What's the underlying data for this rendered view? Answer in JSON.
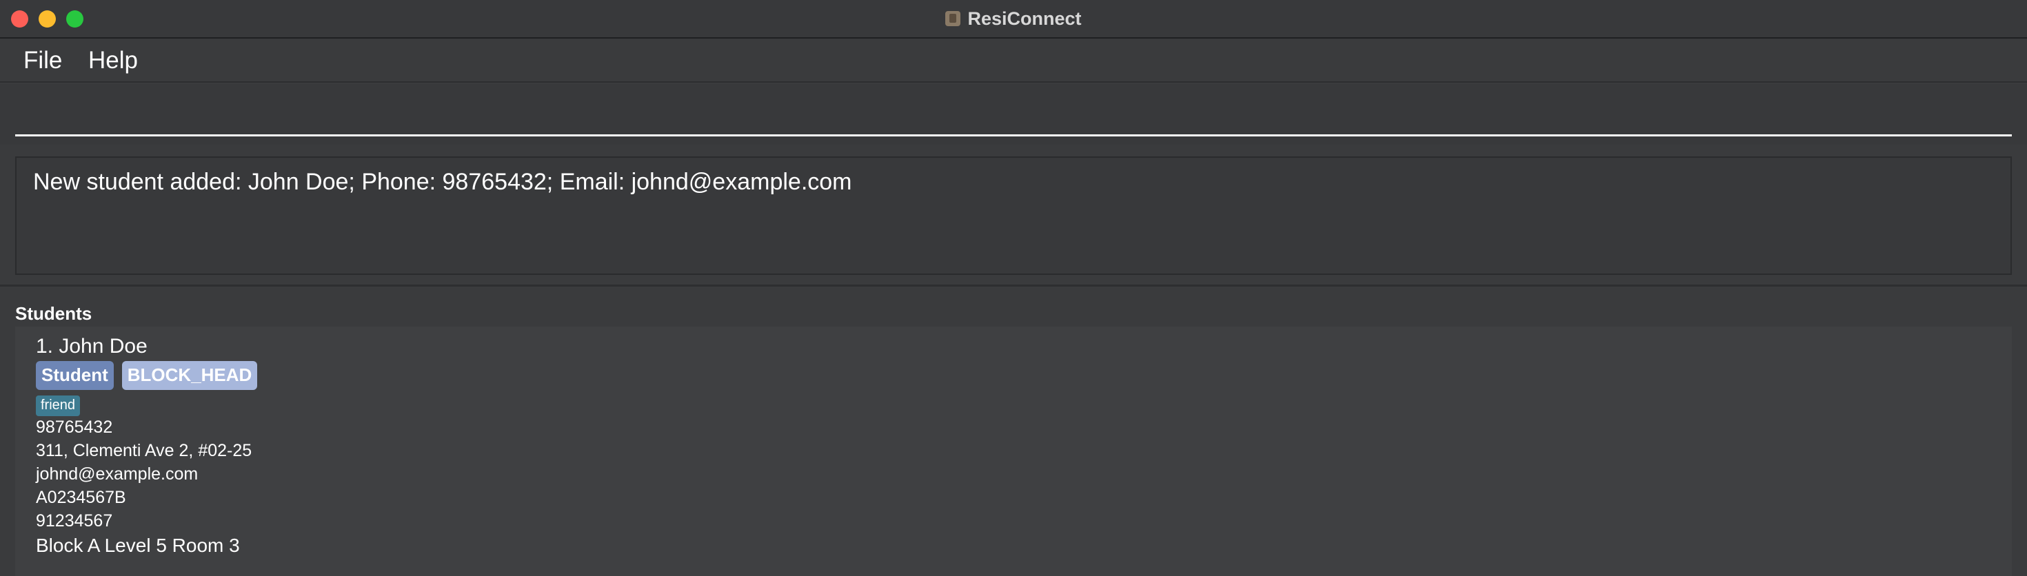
{
  "window": {
    "title": "ResiConnect"
  },
  "menu": {
    "file": "File",
    "help": "Help"
  },
  "command": {
    "value": "",
    "placeholder": ""
  },
  "result": {
    "message": "New student added: John Doe; Phone: 98765432; Email: johnd@example.com"
  },
  "list": {
    "label": "Students",
    "students": [
      {
        "name_line": "1. John Doe",
        "role_tags": [
          "Student",
          "BLOCK_HEAD"
        ],
        "tag": "friend",
        "phone": "98765432",
        "address": "311, Clementi Ave 2, #02-25",
        "email": "johnd@example.com",
        "student_id": "A0234567B",
        "emergency_phone": "91234567",
        "location": "Block A  Level 5  Room 3"
      }
    ]
  },
  "colors": {
    "background": "#3a3b3d",
    "role_tag_student": "#6e86b6",
    "role_tag_block_head": "#a7b7dc",
    "friend_tag": "#3e7b91",
    "close": "#fe5f57",
    "minimize": "#febc2e",
    "maximize": "#28c840"
  },
  "icons": {
    "app": "resiconnect-app-icon"
  }
}
